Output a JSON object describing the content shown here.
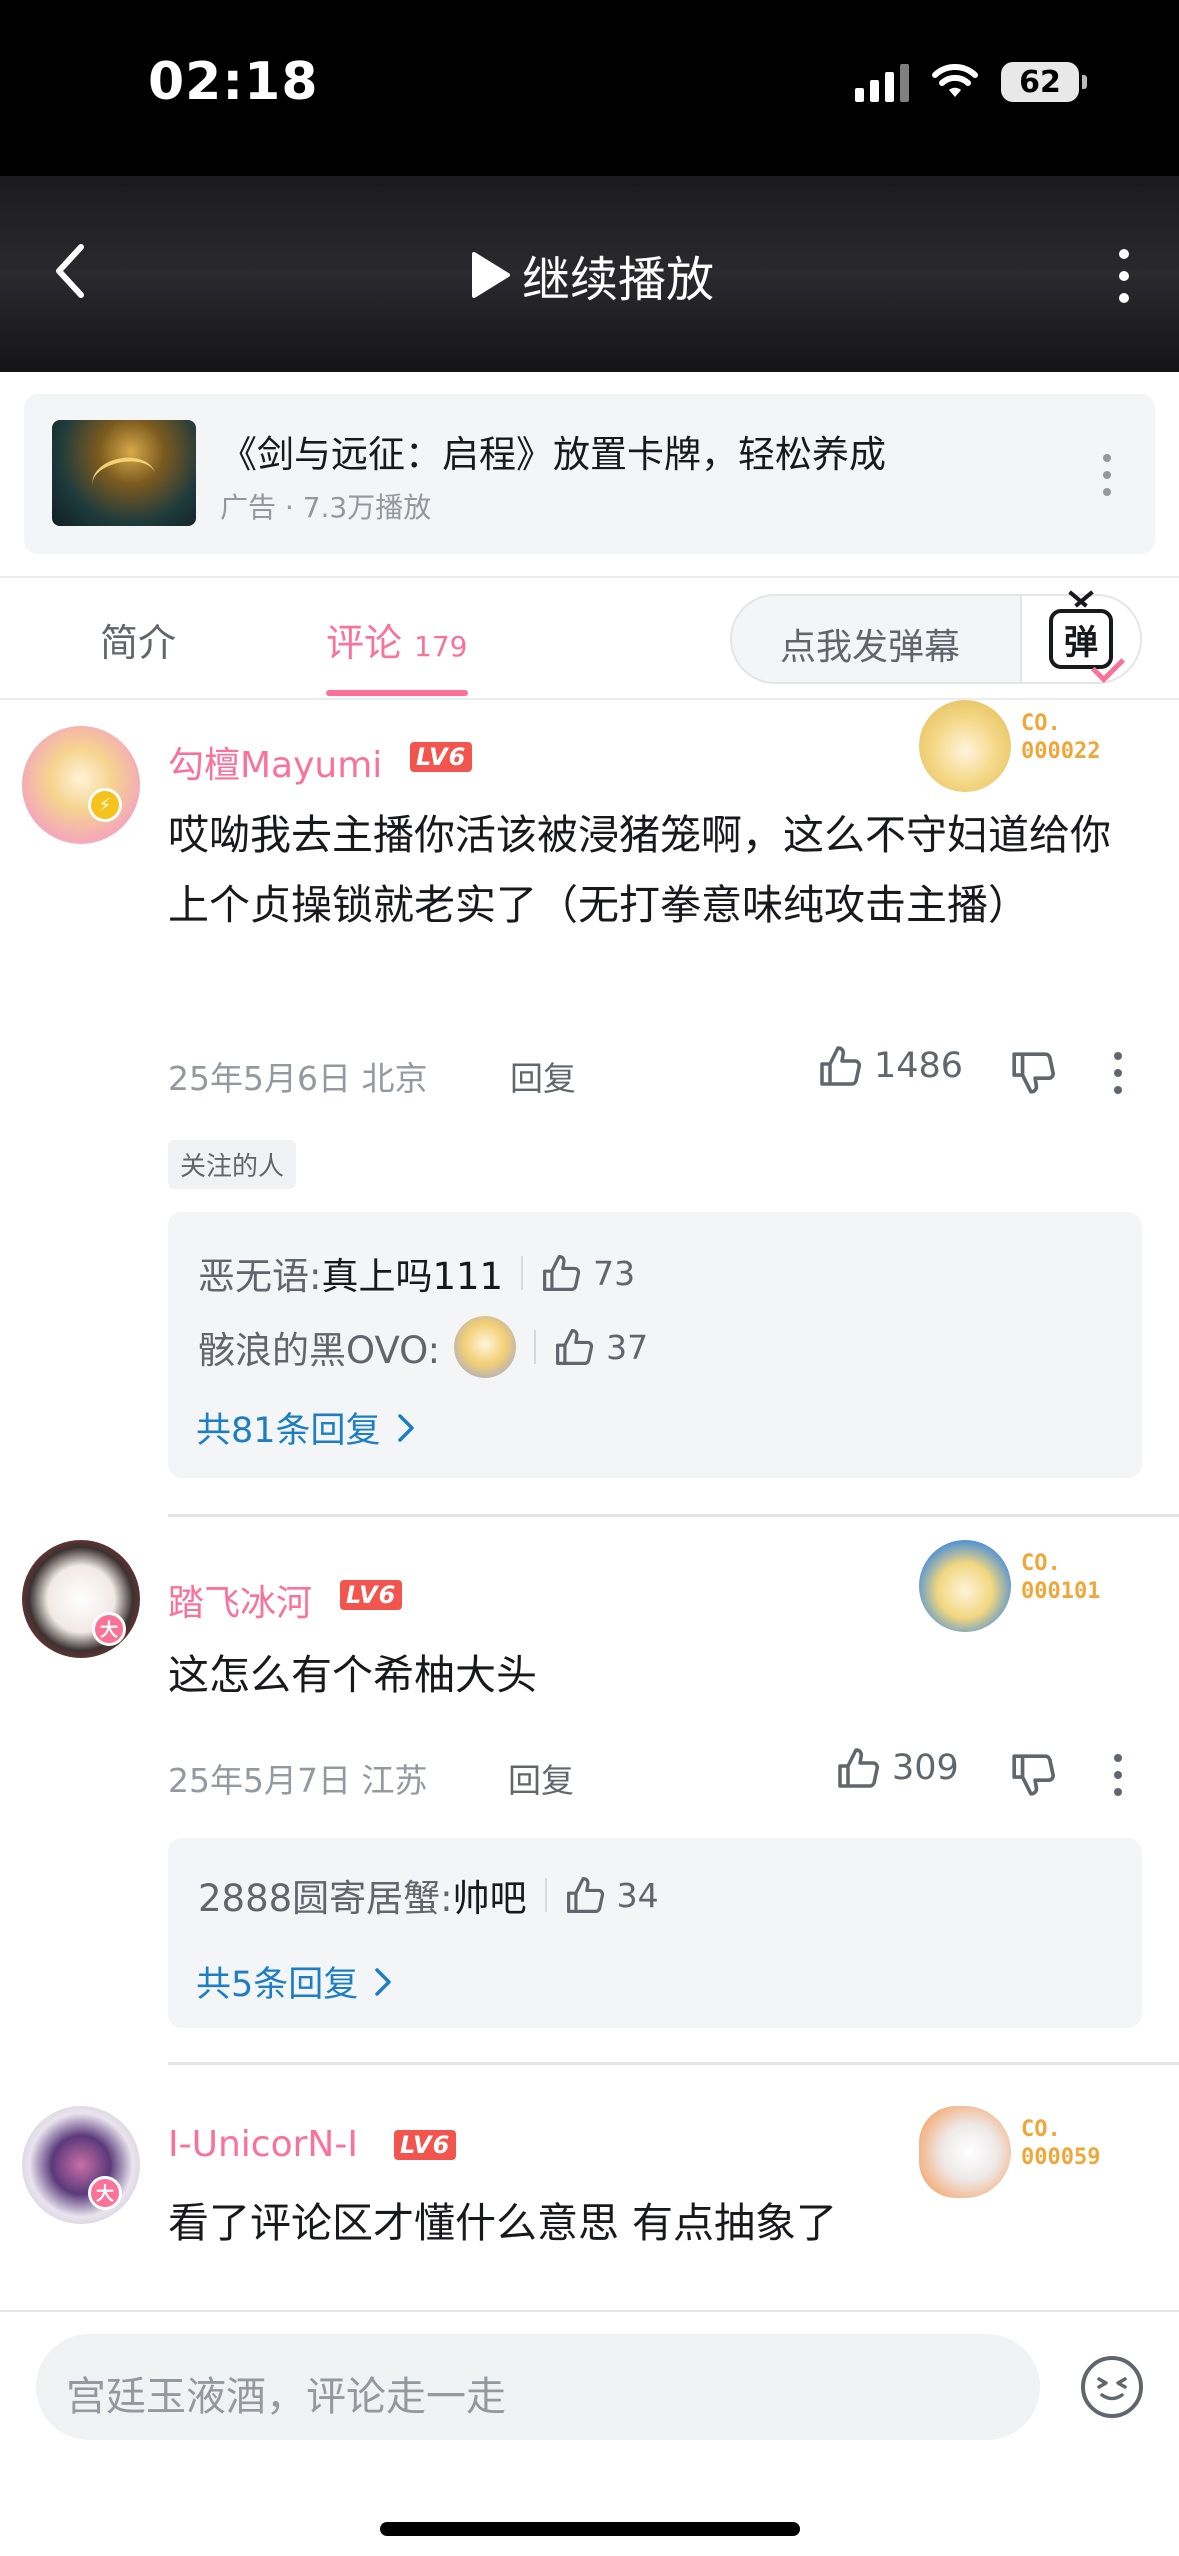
{
  "status_bar": {
    "time": "02:18",
    "battery": "62"
  },
  "player": {
    "continue_label": "继续播放"
  },
  "ad": {
    "title": "《剑与远征：启程》放置卡牌，轻松养成",
    "subtitle": "广告 · 7.3万播放"
  },
  "tabs": {
    "intro": "简介",
    "comments": "评论",
    "comment_count": "179",
    "danmaku_placeholder": "点我发弹幕",
    "danmaku_icon_glyph": "弹"
  },
  "comments": [
    {
      "username": "勾檀Mayumi",
      "level": "LV6",
      "fan_badge": {
        "line1": "CO.",
        "line2": "000022"
      },
      "content": "哎呦我去主播你活该被浸猪笼啊，这么不守妇道给你上个贞操锁就老实了（无打拳意味纯攻击主播）",
      "date_loc": "25年5月6日 北京",
      "reply_label": "回复",
      "likes": "1486",
      "tag": "关注的人",
      "replies": [
        {
          "name": "恶无语:",
          "text": "真上吗111",
          "likes": "73"
        },
        {
          "name": "骸浪的黑OVO:",
          "text": "",
          "likes": "37"
        }
      ],
      "total_replies": "共81条回复"
    },
    {
      "username": "踏飞冰河",
      "level": "LV6",
      "fan_badge": {
        "line1": "CO.",
        "line2": "000101"
      },
      "content": "这怎么有个希柚大头",
      "date_loc": "25年5月7日 江苏",
      "reply_label": "回复",
      "likes": "309",
      "replies": [
        {
          "name": "2888圆寄居蟹:",
          "text": "帅吧",
          "likes": "34"
        }
      ],
      "total_replies": "共5条回复"
    },
    {
      "username": "I-UnicorN-I",
      "level": "LV6",
      "fan_badge": {
        "line1": "CO.",
        "line2": "000059"
      },
      "content": "看了评论区才懂什么意思 有点抽象了"
    }
  ],
  "bottom": {
    "placeholder": "宫廷玉液酒，评论走一走"
  },
  "colors": {
    "accent": "#fb7299",
    "link": "#1d7fc2",
    "level_badge": "#f2554e",
    "fan_badge": "#f0a73a"
  },
  "icons": [
    "back-icon",
    "play-icon",
    "more-icon",
    "danmaku-icon",
    "thumb-up-icon",
    "thumb-down-icon",
    "chevron-right-icon",
    "emoji-icon",
    "wifi-icon",
    "signal-icon",
    "battery-icon"
  ]
}
